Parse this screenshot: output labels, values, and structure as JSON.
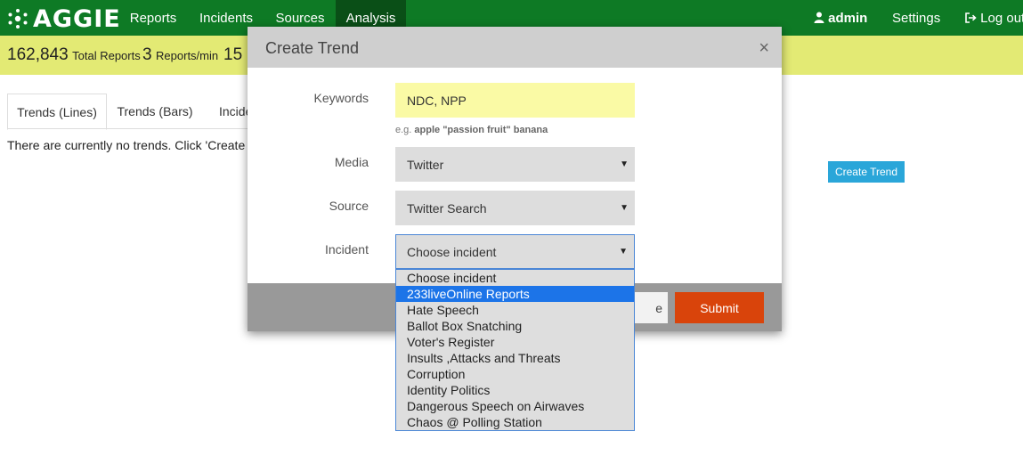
{
  "nav": {
    "brand": "AGGIE",
    "links": [
      {
        "label": "Reports",
        "active": false
      },
      {
        "label": "Incidents",
        "active": false
      },
      {
        "label": "Sources",
        "active": false
      },
      {
        "label": "Analysis",
        "active": true
      }
    ],
    "user": "admin",
    "settings": "Settings",
    "logout": "Log out"
  },
  "stats": {
    "total_reports": "162,843",
    "total_reports_label": "Total Reports",
    "reports_per_min": "3",
    "reports_per_min_label": "Reports/min",
    "partial": "15"
  },
  "tabs": [
    "Trends (Lines)",
    "Trends (Bars)",
    "Incide"
  ],
  "empty_message": "There are currently no trends. Click 'Create Tren",
  "create_trend_button": "Create Trend",
  "modal": {
    "title": "Create Trend",
    "close": "×",
    "keywords_label": "Keywords",
    "keywords_value": "NDC, NPP",
    "keywords_help_prefix": "e.g.",
    "keywords_help_example": "apple \"passion fruit\" banana",
    "media_label": "Media",
    "media_value": "Twitter",
    "source_label": "Source",
    "source_value": "Twitter Search",
    "incident_label": "Incident",
    "incident_value": "Choose incident",
    "cancel_partial": "e",
    "submit": "Submit"
  },
  "incident_options": [
    {
      "label": "Choose incident",
      "selected": false
    },
    {
      "label": "233liveOnline Reports",
      "selected": true
    },
    {
      "label": "Hate Speech",
      "selected": false
    },
    {
      "label": "Ballot Box Snatching",
      "selected": false
    },
    {
      "label": "Voter's Register",
      "selected": false
    },
    {
      "label": "Insults ,Attacks and Threats",
      "selected": false
    },
    {
      "label": "Corruption",
      "selected": false
    },
    {
      "label": "Identity Politics",
      "selected": false
    },
    {
      "label": "Dangerous Speech on Airwaves",
      "selected": false
    },
    {
      "label": "Chaos @ Polling Station",
      "selected": false
    }
  ],
  "colors": {
    "navbar": "#0e7a25",
    "navbar_active": "#0a4f17",
    "statsbar": "#e3ea74",
    "submit": "#d9440b",
    "create_trend": "#2aa6d9",
    "selected_option": "#1c74e8"
  }
}
